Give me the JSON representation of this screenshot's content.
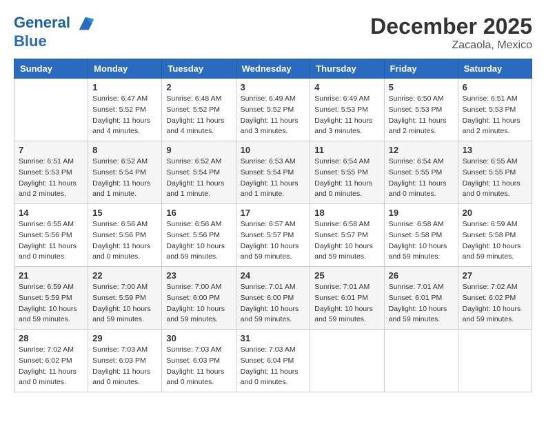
{
  "logo": {
    "line1": "General",
    "line2": "Blue"
  },
  "title": "December 2025",
  "location": "Zacaola, Mexico",
  "days_of_week": [
    "Sunday",
    "Monday",
    "Tuesday",
    "Wednesday",
    "Thursday",
    "Friday",
    "Saturday"
  ],
  "weeks": [
    [
      {
        "day": "",
        "info": ""
      },
      {
        "day": "1",
        "info": "Sunrise: 6:47 AM\nSunset: 5:52 PM\nDaylight: 11 hours\nand 4 minutes."
      },
      {
        "day": "2",
        "info": "Sunrise: 6:48 AM\nSunset: 5:52 PM\nDaylight: 11 hours\nand 4 minutes."
      },
      {
        "day": "3",
        "info": "Sunrise: 6:49 AM\nSunset: 5:52 PM\nDaylight: 11 hours\nand 3 minutes."
      },
      {
        "day": "4",
        "info": "Sunrise: 6:49 AM\nSunset: 5:53 PM\nDaylight: 11 hours\nand 3 minutes."
      },
      {
        "day": "5",
        "info": "Sunrise: 6:50 AM\nSunset: 5:53 PM\nDaylight: 11 hours\nand 2 minutes."
      },
      {
        "day": "6",
        "info": "Sunrise: 6:51 AM\nSunset: 5:53 PM\nDaylight: 11 hours\nand 2 minutes."
      }
    ],
    [
      {
        "day": "7",
        "info": "Sunrise: 6:51 AM\nSunset: 5:53 PM\nDaylight: 11 hours\nand 2 minutes."
      },
      {
        "day": "8",
        "info": "Sunrise: 6:52 AM\nSunset: 5:54 PM\nDaylight: 11 hours\nand 1 minute."
      },
      {
        "day": "9",
        "info": "Sunrise: 6:52 AM\nSunset: 5:54 PM\nDaylight: 11 hours\nand 1 minute."
      },
      {
        "day": "10",
        "info": "Sunrise: 6:53 AM\nSunset: 5:54 PM\nDaylight: 11 hours\nand 1 minute."
      },
      {
        "day": "11",
        "info": "Sunrise: 6:54 AM\nSunset: 5:55 PM\nDaylight: 11 hours\nand 0 minutes."
      },
      {
        "day": "12",
        "info": "Sunrise: 6:54 AM\nSunset: 5:55 PM\nDaylight: 11 hours\nand 0 minutes."
      },
      {
        "day": "13",
        "info": "Sunrise: 6:55 AM\nSunset: 5:55 PM\nDaylight: 11 hours\nand 0 minutes."
      }
    ],
    [
      {
        "day": "14",
        "info": "Sunrise: 6:55 AM\nSunset: 5:56 PM\nDaylight: 11 hours\nand 0 minutes."
      },
      {
        "day": "15",
        "info": "Sunrise: 6:56 AM\nSunset: 5:56 PM\nDaylight: 11 hours\nand 0 minutes."
      },
      {
        "day": "16",
        "info": "Sunrise: 6:56 AM\nSunset: 5:56 PM\nDaylight: 10 hours\nand 59 minutes."
      },
      {
        "day": "17",
        "info": "Sunrise: 6:57 AM\nSunset: 5:57 PM\nDaylight: 10 hours\nand 59 minutes."
      },
      {
        "day": "18",
        "info": "Sunrise: 6:58 AM\nSunset: 5:57 PM\nDaylight: 10 hours\nand 59 minutes."
      },
      {
        "day": "19",
        "info": "Sunrise: 6:58 AM\nSunset: 5:58 PM\nDaylight: 10 hours\nand 59 minutes."
      },
      {
        "day": "20",
        "info": "Sunrise: 6:59 AM\nSunset: 5:58 PM\nDaylight: 10 hours\nand 59 minutes."
      }
    ],
    [
      {
        "day": "21",
        "info": "Sunrise: 6:59 AM\nSunset: 5:59 PM\nDaylight: 10 hours\nand 59 minutes."
      },
      {
        "day": "22",
        "info": "Sunrise: 7:00 AM\nSunset: 5:59 PM\nDaylight: 10 hours\nand 59 minutes."
      },
      {
        "day": "23",
        "info": "Sunrise: 7:00 AM\nSunset: 6:00 PM\nDaylight: 10 hours\nand 59 minutes."
      },
      {
        "day": "24",
        "info": "Sunrise: 7:01 AM\nSunset: 6:00 PM\nDaylight: 10 hours\nand 59 minutes."
      },
      {
        "day": "25",
        "info": "Sunrise: 7:01 AM\nSunset: 6:01 PM\nDaylight: 10 hours\nand 59 minutes."
      },
      {
        "day": "26",
        "info": "Sunrise: 7:01 AM\nSunset: 6:01 PM\nDaylight: 10 hours\nand 59 minutes."
      },
      {
        "day": "27",
        "info": "Sunrise: 7:02 AM\nSunset: 6:02 PM\nDaylight: 10 hours\nand 59 minutes."
      }
    ],
    [
      {
        "day": "28",
        "info": "Sunrise: 7:02 AM\nSunset: 6:02 PM\nDaylight: 11 hours\nand 0 minutes."
      },
      {
        "day": "29",
        "info": "Sunrise: 7:03 AM\nSunset: 6:03 PM\nDaylight: 11 hours\nand 0 minutes."
      },
      {
        "day": "30",
        "info": "Sunrise: 7:03 AM\nSunset: 6:03 PM\nDaylight: 11 hours\nand 0 minutes."
      },
      {
        "day": "31",
        "info": "Sunrise: 7:03 AM\nSunset: 6:04 PM\nDaylight: 11 hours\nand 0 minutes."
      },
      {
        "day": "",
        "info": ""
      },
      {
        "day": "",
        "info": ""
      },
      {
        "day": "",
        "info": ""
      }
    ]
  ]
}
